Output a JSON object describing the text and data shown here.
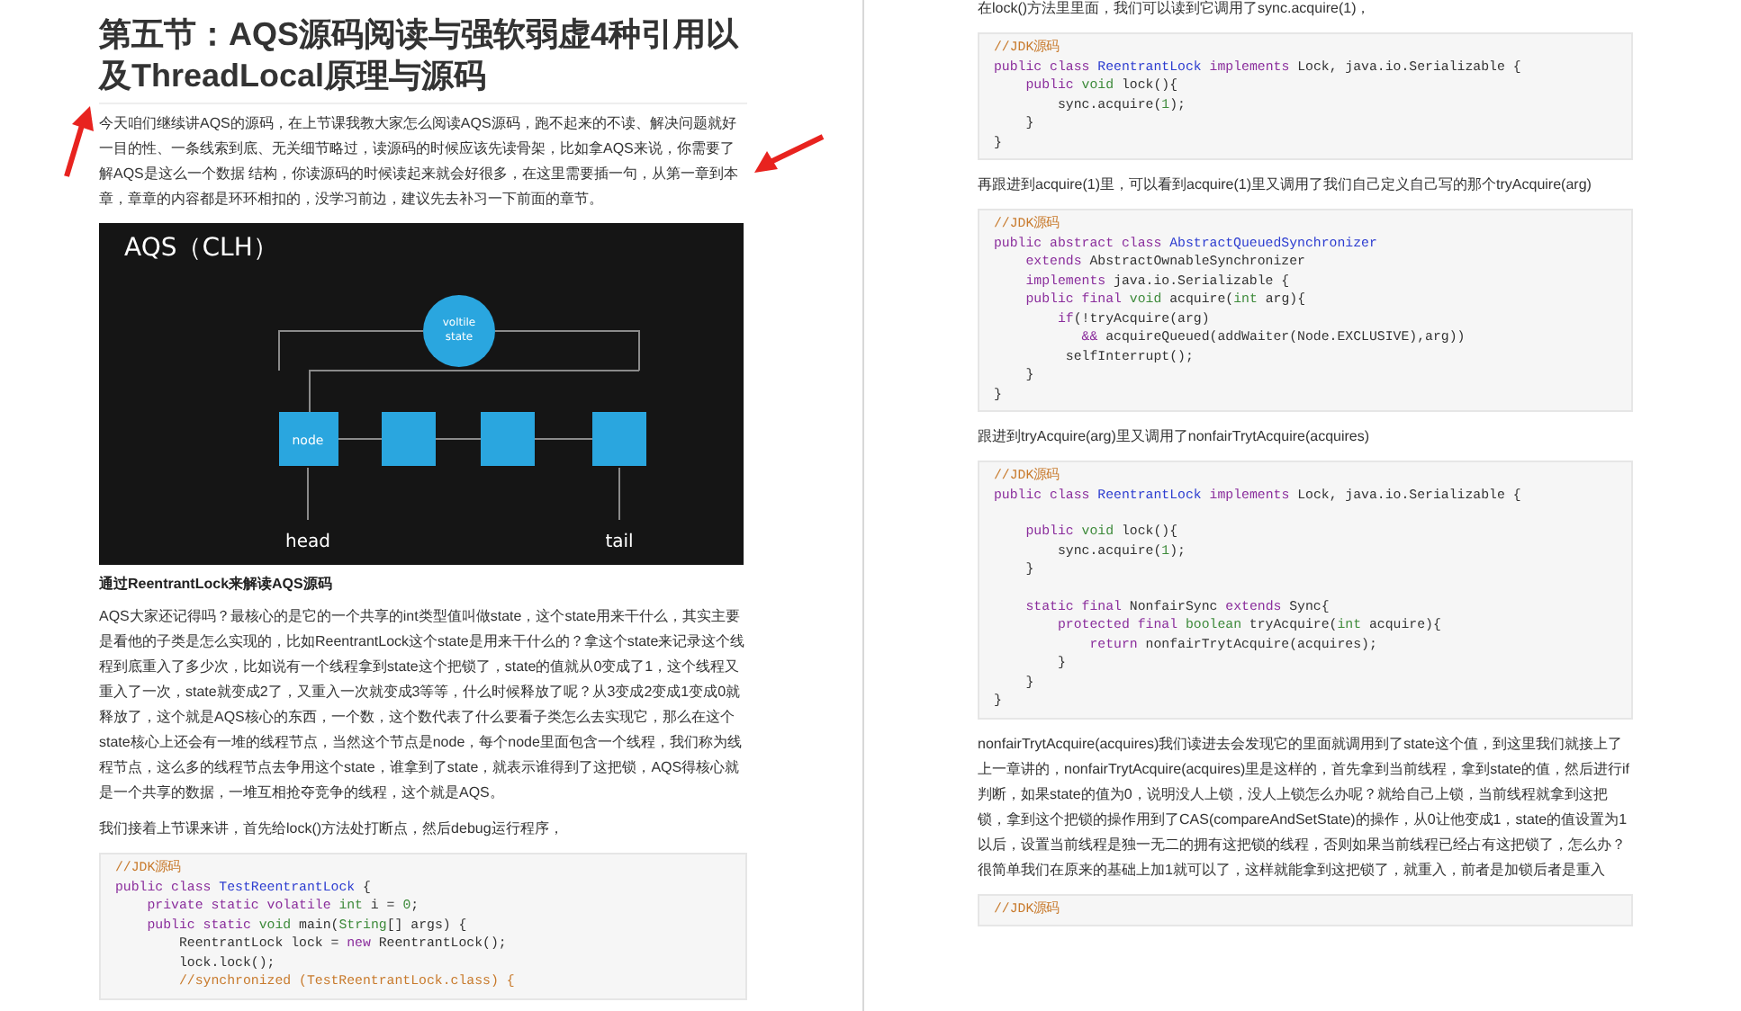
{
  "pages": [
    {
      "blocks": [
        {
          "kind": "heading",
          "text": "第五节：AQS源码阅读与强软弱虚4种引用以及ThreadLocal原理与源码"
        },
        {
          "kind": "paragraph",
          "text": "今天咱们继续讲AQS的源码，在上节课我教大家怎么阅读AQS源码，跑不起来的不读、解决问题就好一目的性、一条线索到底、无关细节略过，读源码的时候应该先读骨架，比如拿AQS来说，你需要了解AQS是这么一个数据 结构，你读源码的时候读起来就会好很多，在这里需要插一句，从第一章到本章，章章的内容都是环环相扣的，没学习前边，建议先去补习一下前面的章节。"
        },
        {
          "kind": "figure",
          "title": "AQS（CLH）",
          "state_label": [
            "voltile",
            "state"
          ],
          "node_label": "node",
          "head_label": "head",
          "tail_label": "tail"
        },
        {
          "kind": "subheading",
          "text": "通过ReentrantLock来解读AQS源码"
        },
        {
          "kind": "paragraph",
          "text": " AQS大家还记得吗？最核心的是它的一个共享的int类型值叫做state，这个state用来干什么，其实主要是看他的子类是怎么实现的，比如ReentrantLock这个state是用来干什么的？拿这个state来记录这个线程到底重入了多少次，比如说有一个线程拿到state这个把锁了，state的值就从0变成了1，这个线程又重入了一次，state就变成2了，又重入一次就变成3等等，什么时候释放了呢？从3变成2变成1变成0就释放了，这个就是AQS核心的东西，一个数，这个数代表了什么要看子类怎么去实现它，那么在这个state核心上还会有一堆的线程节点，当然这个节点是node，每个node里面包含一个线程，我们称为线程节点，这么多的线程节点去争用这个state，谁拿到了state，就表示谁得到了这把锁，AQS得核心就是一个共享的数据，一堆互相抢夺竞争的线程，这个就是AQS。"
        },
        {
          "kind": "paragraph",
          "text": "我们接着上节课来讲，首先给lock()方法处打断点，然后debug运行程序，"
        },
        {
          "kind": "code",
          "lines": [
            {
              "tokens": [
                {
                  "kind": "comment",
                  "text": "//JDK源码"
                }
              ]
            },
            {
              "tokens": [
                {
                  "kind": "keyword",
                  "text": "public class "
                },
                {
                  "kind": "class",
                  "text": "TestReentrantLock"
                },
                {
                  "kind": "plain",
                  "text": " {"
                }
              ]
            },
            {
              "tokens": [
                {
                  "kind": "keyword",
                  "text": "    private static volatile "
                },
                {
                  "kind": "type",
                  "text": "int"
                },
                {
                  "kind": "plain",
                  "text": " i = "
                },
                {
                  "kind": "number",
                  "text": "0"
                },
                {
                  "kind": "plain",
                  "text": ";"
                }
              ]
            },
            {
              "tokens": [
                {
                  "kind": "keyword",
                  "text": "    public static "
                },
                {
                  "kind": "type",
                  "text": "void"
                },
                {
                  "kind": "plain",
                  "text": " main("
                },
                {
                  "kind": "type",
                  "text": "String"
                },
                {
                  "kind": "plain",
                  "text": "[] args) {"
                }
              ]
            },
            {
              "tokens": [
                {
                  "kind": "plain",
                  "text": "        ReentrantLock lock = "
                },
                {
                  "kind": "keyword",
                  "text": "new"
                },
                {
                  "kind": "plain",
                  "text": " ReentrantLock();"
                }
              ]
            },
            {
              "tokens": [
                {
                  "kind": "plain",
                  "text": "        lock.lock();"
                }
              ]
            },
            {
              "tokens": [
                {
                  "kind": "comment",
                  "text": "        //synchronized (TestReentrantLock.class) {"
                }
              ]
            }
          ]
        }
      ]
    },
    {
      "blocks": [
        {
          "kind": "paragraph",
          "text": "在lock()方法里里面，我们可以读到它调用了sync.acquire(1)，"
        },
        {
          "kind": "code",
          "lines": [
            {
              "tokens": [
                {
                  "kind": "comment",
                  "text": "//JDK源码"
                }
              ]
            },
            {
              "tokens": [
                {
                  "kind": "keyword",
                  "text": "public class "
                },
                {
                  "kind": "class",
                  "text": "ReentrantLock"
                },
                {
                  "kind": "keyword",
                  "text": " implements"
                },
                {
                  "kind": "plain",
                  "text": " Lock, java.io.Serializable {"
                }
              ]
            },
            {
              "tokens": [
                {
                  "kind": "keyword",
                  "text": "    public "
                },
                {
                  "kind": "type",
                  "text": "void"
                },
                {
                  "kind": "plain",
                  "text": " lock(){"
                }
              ]
            },
            {
              "tokens": [
                {
                  "kind": "plain",
                  "text": "        sync.acquire("
                },
                {
                  "kind": "number",
                  "text": "1"
                },
                {
                  "kind": "plain",
                  "text": ");"
                }
              ]
            },
            {
              "tokens": [
                {
                  "kind": "plain",
                  "text": "    }"
                }
              ]
            },
            {
              "tokens": [
                {
                  "kind": "plain",
                  "text": "}"
                }
              ]
            }
          ]
        },
        {
          "kind": "paragraph",
          "text": "再跟进到acquire(1)里，可以看到acquire(1)里又调用了我们自己定义自己写的那个tryAcquire(arg)"
        },
        {
          "kind": "code",
          "lines": [
            {
              "tokens": [
                {
                  "kind": "comment",
                  "text": "//JDK源码"
                }
              ]
            },
            {
              "tokens": [
                {
                  "kind": "keyword",
                  "text": "public abstract class "
                },
                {
                  "kind": "class",
                  "text": "AbstractQueuedSynchronizer"
                }
              ]
            },
            {
              "tokens": [
                {
                  "kind": "keyword",
                  "text": "    extends"
                },
                {
                  "kind": "plain",
                  "text": " AbstractOwnableSynchronizer"
                }
              ]
            },
            {
              "tokens": [
                {
                  "kind": "keyword",
                  "text": "    implements"
                },
                {
                  "kind": "plain",
                  "text": " java.io.Serializable {"
                }
              ]
            },
            {
              "tokens": [
                {
                  "kind": "keyword",
                  "text": "    public final "
                },
                {
                  "kind": "type",
                  "text": "void"
                },
                {
                  "kind": "plain",
                  "text": " acquire("
                },
                {
                  "kind": "type",
                  "text": "int"
                },
                {
                  "kind": "plain",
                  "text": " arg){"
                }
              ]
            },
            {
              "tokens": [
                {
                  "kind": "keyword",
                  "text": "        if"
                },
                {
                  "kind": "plain",
                  "text": "(!tryAcquire(arg)"
                }
              ]
            },
            {
              "tokens": [
                {
                  "kind": "keyword",
                  "text": "           &&"
                },
                {
                  "kind": "plain",
                  "text": " acquireQueued(addWaiter(Node.EXCLUSIVE),arg))"
                }
              ]
            },
            {
              "tokens": [
                {
                  "kind": "plain",
                  "text": "         selfInterrupt();"
                }
              ]
            },
            {
              "tokens": [
                {
                  "kind": "plain",
                  "text": "    }"
                }
              ]
            },
            {
              "tokens": [
                {
                  "kind": "plain",
                  "text": "}"
                }
              ]
            }
          ]
        },
        {
          "kind": "paragraph",
          "text": "跟进到tryAcquire(arg)里又调用了nonfairTrytAcquire(acquires)"
        },
        {
          "kind": "code",
          "lines": [
            {
              "tokens": [
                {
                  "kind": "comment",
                  "text": "//JDK源码"
                }
              ]
            },
            {
              "tokens": [
                {
                  "kind": "keyword",
                  "text": "public class "
                },
                {
                  "kind": "class",
                  "text": "ReentrantLock"
                },
                {
                  "kind": "keyword",
                  "text": " implements"
                },
                {
                  "kind": "plain",
                  "text": " Lock, java.io.Serializable {"
                }
              ]
            },
            {
              "gap_before": true,
              "tokens": [
                {
                  "kind": "keyword",
                  "text": "    public "
                },
                {
                  "kind": "type",
                  "text": "void"
                },
                {
                  "kind": "plain",
                  "text": " lock(){"
                }
              ]
            },
            {
              "tokens": [
                {
                  "kind": "plain",
                  "text": "        sync.acquire("
                },
                {
                  "kind": "number",
                  "text": "1"
                },
                {
                  "kind": "plain",
                  "text": ");"
                }
              ]
            },
            {
              "tokens": [
                {
                  "kind": "plain",
                  "text": "    }"
                }
              ]
            },
            {
              "gap_before": true,
              "tokens": [
                {
                  "kind": "keyword",
                  "text": "    static final"
                },
                {
                  "kind": "plain",
                  "text": " NonfairSync "
                },
                {
                  "kind": "keyword",
                  "text": "extends"
                },
                {
                  "kind": "plain",
                  "text": " Sync{"
                }
              ]
            },
            {
              "tokens": [
                {
                  "kind": "keyword",
                  "text": "        protected final "
                },
                {
                  "kind": "type",
                  "text": "boolean"
                },
                {
                  "kind": "plain",
                  "text": " tryAcquire("
                },
                {
                  "kind": "type",
                  "text": "int"
                },
                {
                  "kind": "plain",
                  "text": " acquire){"
                }
              ]
            },
            {
              "tokens": [
                {
                  "kind": "keyword",
                  "text": "            return"
                },
                {
                  "kind": "plain",
                  "text": " nonfairTrytAcquire(acquires);"
                }
              ]
            },
            {
              "tokens": [
                {
                  "kind": "plain",
                  "text": "        }"
                }
              ]
            },
            {
              "tokens": [
                {
                  "kind": "plain",
                  "text": "    }"
                }
              ]
            },
            {
              "tokens": [
                {
                  "kind": "plain",
                  "text": "}"
                }
              ]
            }
          ]
        },
        {
          "kind": "paragraph",
          "text": "nonfairTrytAcquire(acquires)我们读进去会发现它的里面就调用到了state这个值，到这里我们就接上了上一章讲的，nonfairTrytAcquire(acquires)里是这样的，首先拿到当前线程，拿到state的值，然后进行if判断，如果state的值为0，说明没人上锁，没人上锁怎么办呢？就给自己上锁，当前线程就拿到这把锁，拿到这个把锁的操作用到了CAS(compareAndSetState)的操作，从0让他变成1，state的值设置为1以后，设置当前线程是独一无二的拥有这把锁的线程，否则如果当前线程已经占有这把锁了，怎么办？很简单我们在原来的基础上加1就可以了，这样就能拿到这把锁了，就重入，前者是加锁后者是重入"
        },
        {
          "kind": "code",
          "lines": [
            {
              "tokens": [
                {
                  "kind": "comment",
                  "text": "//JDK源码"
                }
              ]
            }
          ]
        }
      ]
    }
  ]
}
